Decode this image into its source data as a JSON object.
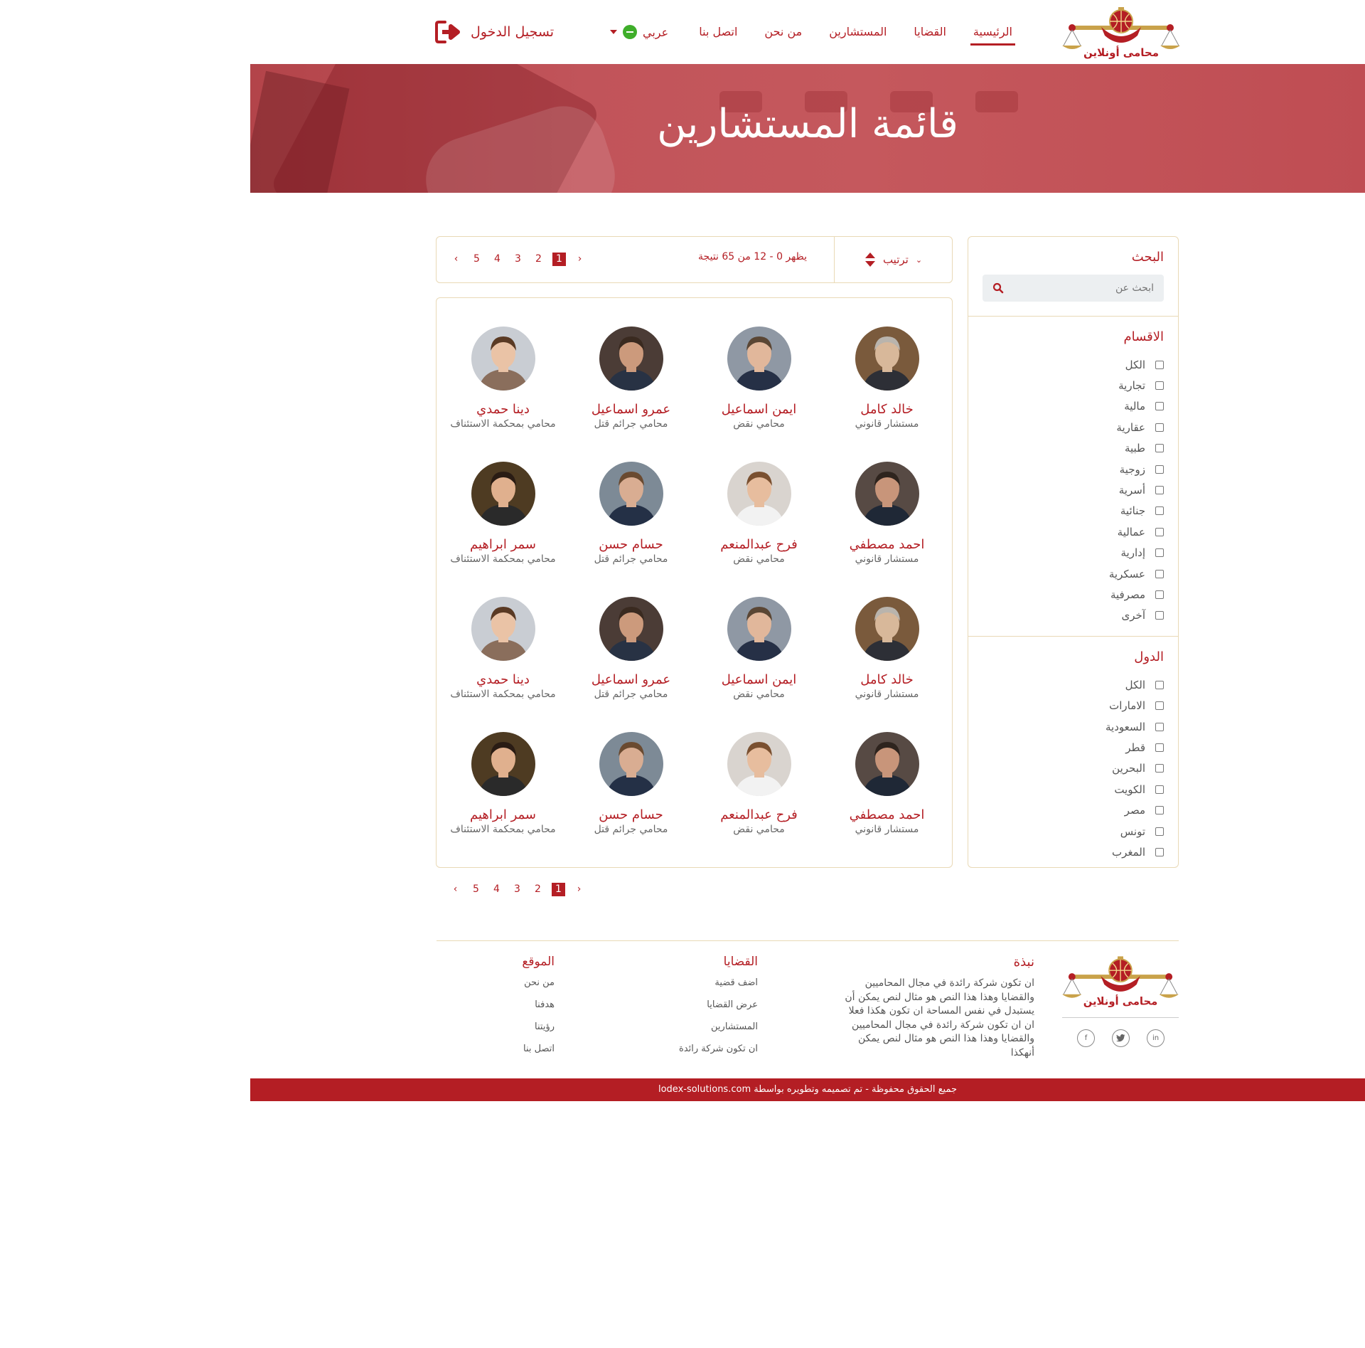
{
  "brand": {
    "logo_text": "محامى أونلاين",
    "primary_color": "#b41e24",
    "border_color": "#e9d9b6"
  },
  "nav": {
    "items": [
      {
        "label": "الرئيسية",
        "active": true
      },
      {
        "label": "القضايا"
      },
      {
        "label": "المستشارين"
      },
      {
        "label": "من نحن"
      },
      {
        "label": "اتصل بنا"
      }
    ],
    "language": "عربي",
    "login": "تسجيل الدخول"
  },
  "hero": {
    "title": "قائمة المستشارين"
  },
  "sidebar": {
    "search_title": "البحث",
    "search_placeholder": "ابحث عن",
    "categories_title": "الاقسام",
    "categories": [
      "الكل",
      "تجارية",
      "مالية",
      "عقارية",
      "طبية",
      "زوجية",
      "أسرية",
      "جنائية",
      "عمالية",
      "إدارية",
      "عسكرية",
      "مصرفية",
      "آخرى"
    ],
    "countries_title": "الدول",
    "countries": [
      "الكل",
      "الامارات",
      "السعودية",
      "قطر",
      "البحرين",
      "الكويت",
      "مصر",
      "تونس",
      "المغرب"
    ]
  },
  "toolbar": {
    "sort_label": "ترتيب",
    "results_text": "يظهر 0 - 12 من 65 نتيجة",
    "pages": [
      "1",
      "2",
      "3",
      "4",
      "5"
    ],
    "current_page": "1"
  },
  "consultants": [
    {
      "name": "خالد كامل",
      "title": "مستشار قانوني"
    },
    {
      "name": "ايمن اسماعيل",
      "title": "محامي نقض"
    },
    {
      "name": "عمرو اسماعيل",
      "title": "محامي جرائم قتل"
    },
    {
      "name": "دينا حمدي",
      "title": "محامي بمحكمة الاستئناف"
    },
    {
      "name": "احمد مصطفي",
      "title": "مستشار قانوني"
    },
    {
      "name": "فرح عبدالمنعم",
      "title": "محامي نقض"
    },
    {
      "name": "حسام حسن",
      "title": "محامي جرائم قتل"
    },
    {
      "name": "سمر ابراهيم",
      "title": "محامي بمحكمة الاستئناف"
    },
    {
      "name": "خالد كامل",
      "title": "مستشار قانوني"
    },
    {
      "name": "ايمن اسماعيل",
      "title": "محامي نقض"
    },
    {
      "name": "عمرو اسماعيل",
      "title": "محامي جرائم قتل"
    },
    {
      "name": "دينا حمدي",
      "title": "محامي بمحكمة الاستئناف"
    },
    {
      "name": "احمد مصطفي",
      "title": "مستشار قانوني"
    },
    {
      "name": "فرح عبدالمنعم",
      "title": "محامي نقض"
    },
    {
      "name": "حسام حسن",
      "title": "محامي جرائم قتل"
    },
    {
      "name": "سمر ابراهيم",
      "title": "محامي بمحكمة الاستئناف"
    }
  ],
  "footer": {
    "about_title": "نبذة",
    "about_text": "ان تكون شركة رائدة في مجال المحاميين والقضايا وهذا  هذا النص هو مثال لنص يمكن أن يستبدل في نفس المساحة ان تكون هكذا فعلا ان ان تكون شركة رائدة في مجال المحاميين والقضايا وهذا  هذا النص هو مثال لنص يمكن أنهكذا",
    "cases_title": "القضايا",
    "cases_links": [
      "اضف قضية",
      "عرض القضايا",
      "المستشارين",
      "ان تكون شركة رائدة"
    ],
    "site_title": "الموقع",
    "site_links": [
      "من نحن",
      "هدفنا",
      "رؤيتنا",
      "اتصل بنا"
    ],
    "socials": [
      "facebook-icon",
      "twitter-icon",
      "linkedin-icon"
    ],
    "copyright": "جميع الحقوق محفوظة - تم تصميمه وتطويره بواسطة lodex-solutions.com"
  }
}
